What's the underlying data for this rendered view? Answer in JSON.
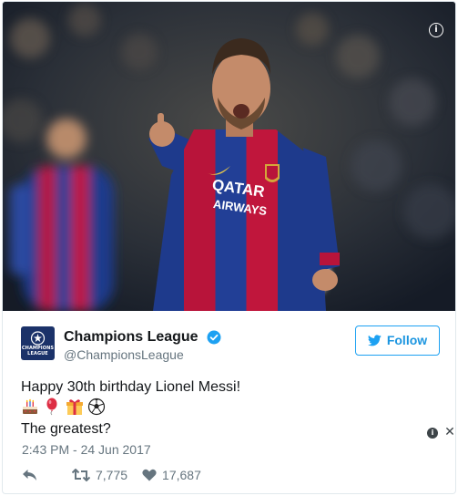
{
  "tweet": {
    "account": {
      "display_name": "Champions League",
      "handle": "@ChampionsLeague",
      "avatar_text": "CHAMPIONS LEAGUE",
      "verified_icon": "verified-badge-icon"
    },
    "follow_label": "Follow",
    "text_line_1": "Happy 30th birthday Lionel Messi!",
    "emojis": [
      "birthday-cake-icon",
      "balloon-icon",
      "gift-icon",
      "soccer-ball-icon"
    ],
    "text_line_2": "The greatest?",
    "timestamp": "2:43 PM - 24 Jun 2017",
    "retweets": "7,775",
    "likes": "17,687",
    "shirt_sponsor": [
      "QATAR",
      "AIRWAYS"
    ]
  },
  "colors": {
    "brand_blue": "#1da1f2",
    "text_primary": "#14171a",
    "text_secondary": "#66757f",
    "border": "#e1e8ed",
    "avatar_bg": "#1b3269"
  }
}
